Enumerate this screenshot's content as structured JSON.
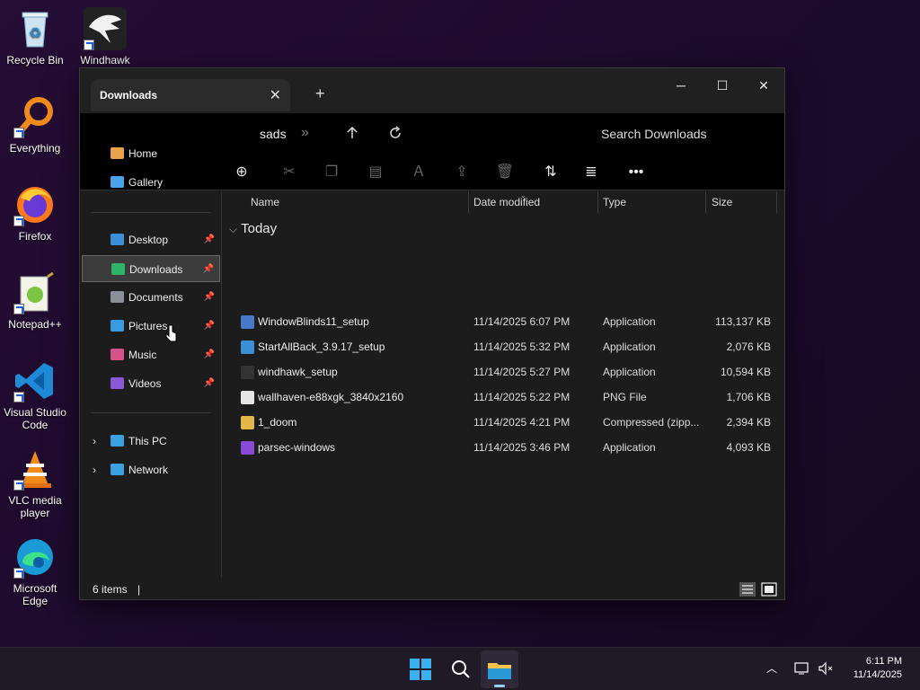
{
  "desktop": {
    "icons": [
      {
        "label": "Recycle Bin",
        "icon": "recycle-bin-icon"
      },
      {
        "label": "Windhawk",
        "icon": "windhawk-icon"
      },
      {
        "label": "Everything",
        "icon": "everything-icon"
      },
      {
        "label": "Firefox",
        "icon": "firefox-icon"
      },
      {
        "label": "Notepad++",
        "icon": "notepadpp-icon"
      },
      {
        "label": "Visual Studio Code",
        "icon": "vscode-icon"
      },
      {
        "label": "VLC media player",
        "icon": "vlc-icon"
      },
      {
        "label": "Microsoft Edge",
        "icon": "edge-icon"
      }
    ]
  },
  "window": {
    "tab_title": "Downloads",
    "close_tab": "✕",
    "new_tab": "+",
    "controls": {
      "minimize": "─",
      "maximize": "☐",
      "close": "✕"
    }
  },
  "address": {
    "path_text": "sads",
    "search_placeholder": "Search Downloads"
  },
  "nav": {
    "items": [
      {
        "label": "Home",
        "icon": "home-icon",
        "color": "#e8a24a"
      },
      {
        "label": "Gallery",
        "icon": "gallery-icon",
        "color": "#4aa3e8"
      },
      {
        "label": "Desktop",
        "icon": "desktop-icon",
        "color": "#3a8fd6"
      },
      {
        "label": "Downloads",
        "icon": "downloads-icon",
        "color": "#2fb36b"
      },
      {
        "label": "Documents",
        "icon": "documents-icon",
        "color": "#8a8f99"
      },
      {
        "label": "Pictures",
        "icon": "pictures-icon",
        "color": "#3a9be0"
      },
      {
        "label": "Music",
        "icon": "music-icon",
        "color": "#d6538a"
      },
      {
        "label": "Videos",
        "icon": "videos-icon",
        "color": "#8a5ad6"
      },
      {
        "label": "This PC",
        "icon": "pc-icon",
        "color": "#3aa0e0"
      },
      {
        "label": "Network",
        "icon": "network-icon",
        "color": "#3aa0e0"
      }
    ]
  },
  "list": {
    "columns": {
      "name": "Name",
      "date": "Date modified",
      "type": "Type",
      "size": "Size"
    },
    "group": "Today",
    "rows": [
      {
        "name": "WindowBlinds11_setup",
        "date": "11/14/2025 6:07 PM",
        "type": "Application",
        "size": "113,137 KB",
        "icon_color": "#4a78c8"
      },
      {
        "name": "StartAllBack_3.9.17_setup",
        "date": "11/14/2025 5:32 PM",
        "type": "Application",
        "size": "2,076 KB",
        "icon_color": "#3a8fd6"
      },
      {
        "name": "windhawk_setup",
        "date": "11/14/2025 5:27 PM",
        "type": "Application",
        "size": "10,594 KB",
        "icon_color": "#333333"
      },
      {
        "name": "wallhaven-e88xgk_3840x2160",
        "date": "11/14/2025 5:22 PM",
        "type": "PNG File",
        "size": "1,706 KB",
        "icon_color": "#e6e6e6"
      },
      {
        "name": "1_doom",
        "date": "11/14/2025 4:21 PM",
        "type": "Compressed (zipp...",
        "size": "2,394 KB",
        "icon_color": "#e3b84a"
      },
      {
        "name": "parsec-windows",
        "date": "11/14/2025 3:46 PM",
        "type": "Application",
        "size": "4,093 KB",
        "icon_color": "#8a4ad6"
      }
    ]
  },
  "status": {
    "count": "6 items",
    "separator": "|"
  },
  "taskbar": {
    "time": "6:11 PM",
    "date": "11/14/2025"
  }
}
